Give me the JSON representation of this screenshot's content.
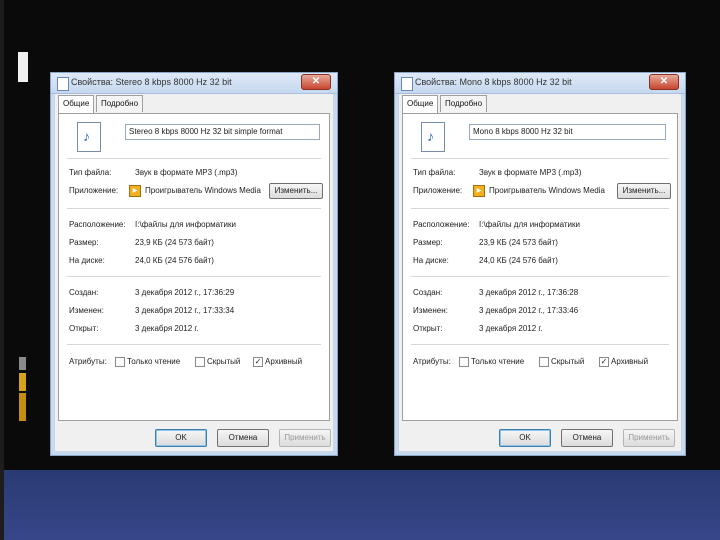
{
  "dialog_left": {
    "title": "Свойства: Stereo 8 kbps 8000 Hz 32 bit",
    "tabs": [
      "Общие",
      "Подробно"
    ],
    "filename": "Stereo 8 kbps 8000 Hz 32 bit simple format",
    "type_label": "Тип файла:",
    "type_value": "Звук в формате MP3 (.mp3)",
    "app_label": "Приложение:",
    "app_value": "Проигрыватель Windows Media",
    "change_button": "Изменить...",
    "location_label": "Расположение:",
    "location_value": "I:\\файлы для информатики",
    "size_label": "Размер:",
    "size_value": "23,9 КБ (24 573 байт)",
    "disk_label": "На диске:",
    "disk_value": "24,0 КБ (24 576 байт)",
    "created_label": "Создан:",
    "created_value": "3 декабря 2012 г., 17:36:29",
    "modified_label": "Изменен:",
    "modified_value": "3 декабря 2012 г., 17:33:34",
    "opened_label": "Открыт:",
    "opened_value": "3 декабря 2012 г.",
    "attr_label": "Атрибуты:",
    "attr_readonly": "Только чтение",
    "attr_hidden": "Скрытый",
    "attr_archive": "Архивный",
    "ok": "OK",
    "cancel": "Отмена",
    "apply": "Применить"
  },
  "dialog_right": {
    "title": "Свойства: Mono 8 kbps 8000 Hz 32 bit",
    "tabs": [
      "Общие",
      "Подробно"
    ],
    "filename": "Mono 8 kbps 8000 Hz 32 bit",
    "type_label": "Тип файла:",
    "type_value": "Звук в формате MP3 (.mp3)",
    "app_label": "Приложение:",
    "app_value": "Проигрыватель Windows Media",
    "change_button": "Изменить...",
    "location_label": "Расположение:",
    "location_value": "I:\\файлы для информатики",
    "size_label": "Размер:",
    "size_value": "23,9 КБ (24 573 байт)",
    "disk_label": "На диске:",
    "disk_value": "24,0 КБ (24 576 байт)",
    "created_label": "Создан:",
    "created_value": "3 декабря 2012 г., 17:36:28",
    "modified_label": "Изменен:",
    "modified_value": "3 декабря 2012 г., 17:33:46",
    "opened_label": "Открыт:",
    "opened_value": "3 декабря 2012 г.",
    "attr_label": "Атрибуты:",
    "attr_readonly": "Только чтение",
    "attr_hidden": "Скрытый",
    "attr_archive": "Архивный",
    "ok": "OK",
    "cancel": "Отмена",
    "apply": "Применить"
  },
  "colors": {
    "slide_bg": "#0a0a0a",
    "footer_band": "#354789",
    "accent_gold": "#d6a21b"
  },
  "icons": {
    "file": "audio-file-icon",
    "app": "windows-media-player-icon",
    "close": "close-icon"
  }
}
